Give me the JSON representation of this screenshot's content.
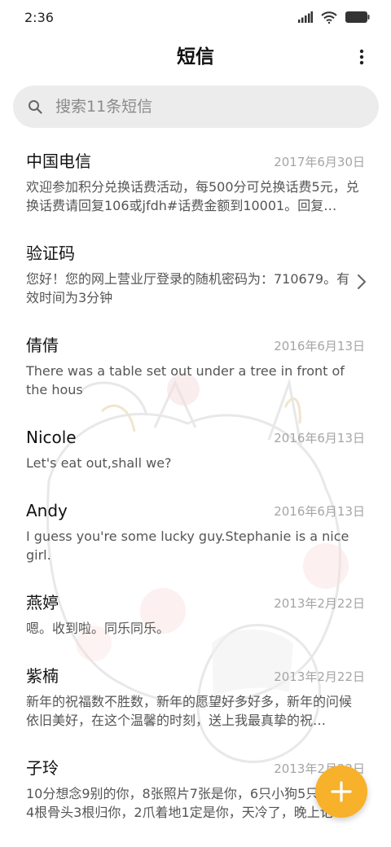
{
  "status_bar": {
    "time": "2:36"
  },
  "header": {
    "title": "短信"
  },
  "search": {
    "placeholder": "搜索11条短信"
  },
  "messages": [
    {
      "sender": "中国电信",
      "date": "2017年6月30日",
      "preview": "欢迎参加积分兑换话费活动，每500分可兑换话费5元，兑换话费请回复106或jfdh#话费金额到10001。回复…"
    },
    {
      "sender": "验证码",
      "date": "",
      "preview": "您好！您的网上营业厅登录的随机密码为：710679。有效时间为3分钟"
    },
    {
      "sender": "倩倩",
      "date": "2016年6月13日",
      "preview": "There was a table set out under a tree in front of the hous"
    },
    {
      "sender": "Nicole",
      "date": "2016年6月13日",
      "preview": "Let's eat out,shall we?"
    },
    {
      "sender": "Andy",
      "date": "2016年6月13日",
      "preview": "I guess you're some lucky guy.Stephanie is a nice girl."
    },
    {
      "sender": "燕婷",
      "date": "2013年2月22日",
      "preview": "嗯。收到啦。同乐同乐。"
    },
    {
      "sender": "紫楠",
      "date": "2013年2月22日",
      "preview": "新年的祝福数不胜数，新年的愿望好多好多，新年的问候依旧美好，在这个温馨的时刻，送上我最真挚的祝…"
    },
    {
      "sender": "子玲",
      "date": "2013年2月22日",
      "preview": "10分想念9别的你，8张照片7张是你，6只小狗5只像你，4根骨头3根归你，2爪着地1定是你，天冷了，晚上记"
    }
  ],
  "colors": {
    "fab": "#f7b12a",
    "search_bg": "#ececec",
    "date": "#a5a5a5"
  },
  "icons": {
    "more": "more-vertical-icon",
    "search": "search-icon",
    "chevron": "chevron-right-icon",
    "fab": "plus-icon"
  }
}
